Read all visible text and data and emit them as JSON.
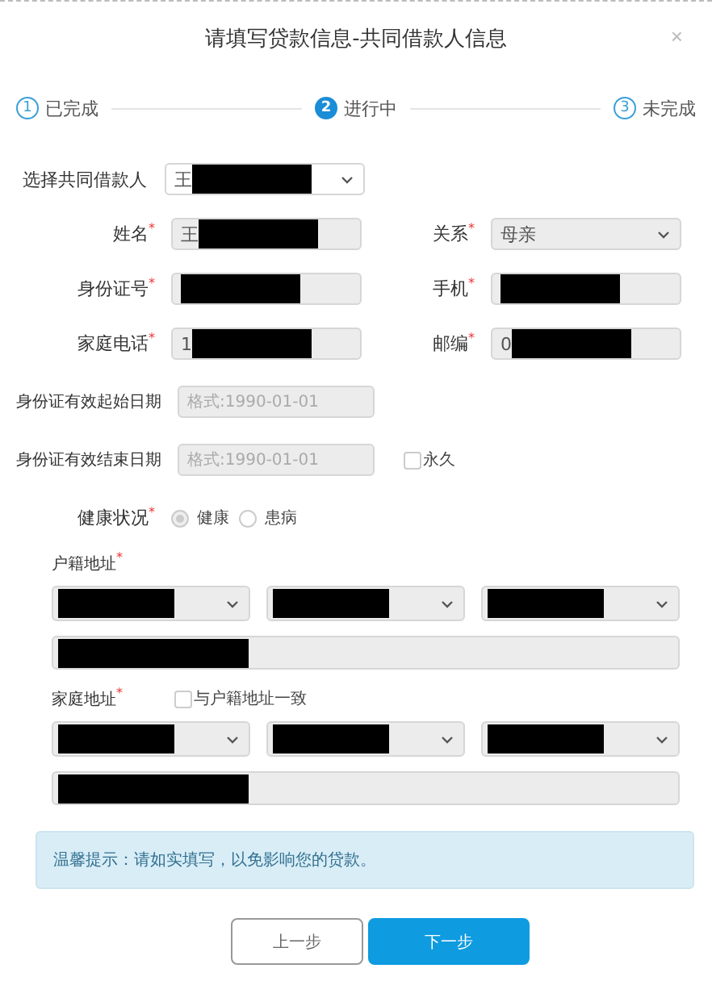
{
  "dialog": {
    "title": "请填写贷款信息-共同借款人信息",
    "close": "×"
  },
  "steps": [
    {
      "number": "1",
      "label": "已完成",
      "selected": false
    },
    {
      "number": "2",
      "label": "进行中",
      "selected": true
    },
    {
      "number": "3",
      "label": "未完成",
      "selected": false
    }
  ],
  "co_borrower": {
    "label": "选择共同借款人",
    "value": "王",
    "redacted": true
  },
  "rows": [
    [
      {
        "label": "姓名",
        "mark": "*",
        "kind": "input",
        "value": "王",
        "redacted": true
      },
      {
        "label": "关系",
        "mark": "*",
        "kind": "select",
        "value": "母亲"
      }
    ],
    [
      {
        "label": "身份证号",
        "mark": "*",
        "kind": "input",
        "redacted": true
      },
      {
        "label": "手机",
        "mark": "*",
        "kind": "input",
        "redacted": true
      }
    ],
    [
      {
        "label": "家庭电话",
        "mark": "*",
        "kind": "input",
        "value": "1",
        "redacted": true
      },
      {
        "label": "邮编",
        "mark": "*",
        "kind": "input",
        "value": "0",
        "redacted": true
      }
    ]
  ],
  "dates": [
    {
      "label": "身份证有效起始日期",
      "placeholder": "格式:1990-01-01"
    },
    {
      "label": "身份证有效结束日期",
      "placeholder": "格式:1990-01-01",
      "checkbox": {
        "label": "永久",
        "checked": false
      }
    }
  ],
  "health": {
    "label": "健康状况",
    "mark": "*",
    "options": [
      {
        "label": "健康",
        "selected": true
      },
      {
        "label": "患病",
        "selected": false
      }
    ]
  },
  "addresses": [
    {
      "label": "户籍地址",
      "mark": "*",
      "selects": [
        {
          "redacted": true
        },
        {
          "redacted": true
        },
        {
          "redacted": true
        }
      ],
      "detail": {
        "redacted": true
      }
    },
    {
      "label": "家庭地址",
      "mark": "*",
      "checkbox": {
        "label": "与户籍地址一致",
        "checked": false
      },
      "selects": [
        {
          "redacted": true
        },
        {
          "redacted": true
        },
        {
          "redacted": true
        }
      ],
      "detail": {
        "redacted": true
      }
    }
  ],
  "notice": "温馨提示：请如实填写，以免影响您的贷款。",
  "buttons": [
    {
      "label": "上一步",
      "kind": "secondary"
    },
    {
      "label": "下一步",
      "kind": "primary"
    }
  ]
}
